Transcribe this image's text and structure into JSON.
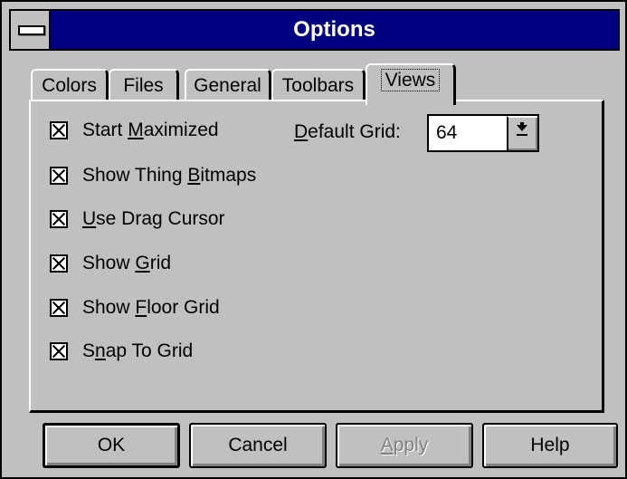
{
  "window": {
    "title": "Options"
  },
  "tabs": [
    {
      "label": "Colors",
      "active": false
    },
    {
      "label": "Files",
      "active": false
    },
    {
      "label": "General",
      "active": false
    },
    {
      "label": "Toolbars",
      "active": false
    },
    {
      "label": "Views",
      "active": true
    }
  ],
  "views": {
    "checkboxes": [
      {
        "pre": "Start ",
        "mn": "M",
        "post": "aximized",
        "checked": true
      },
      {
        "pre": "Show Thing ",
        "mn": "B",
        "post": "itmaps",
        "checked": true
      },
      {
        "pre": "",
        "mn": "U",
        "post": "se Drag Cursor",
        "checked": true
      },
      {
        "pre": "Show ",
        "mn": "G",
        "post": "rid",
        "checked": true
      },
      {
        "pre": "Show ",
        "mn": "F",
        "post": "loor Grid",
        "checked": true
      },
      {
        "pre": "S",
        "mn": "n",
        "post": "ap To Grid",
        "checked": true
      }
    ],
    "default_grid": {
      "label_mn": "D",
      "label_rest": "efault Grid:",
      "value": "64"
    }
  },
  "buttons": {
    "ok": "OK",
    "cancel": "Cancel",
    "apply_mn": "A",
    "apply_rest": "pply",
    "help": "Help"
  },
  "icons": {
    "system_menu": "system-menu-icon",
    "dropdown": "dropdown-arrow-icon",
    "check": "checkmark-icon"
  }
}
